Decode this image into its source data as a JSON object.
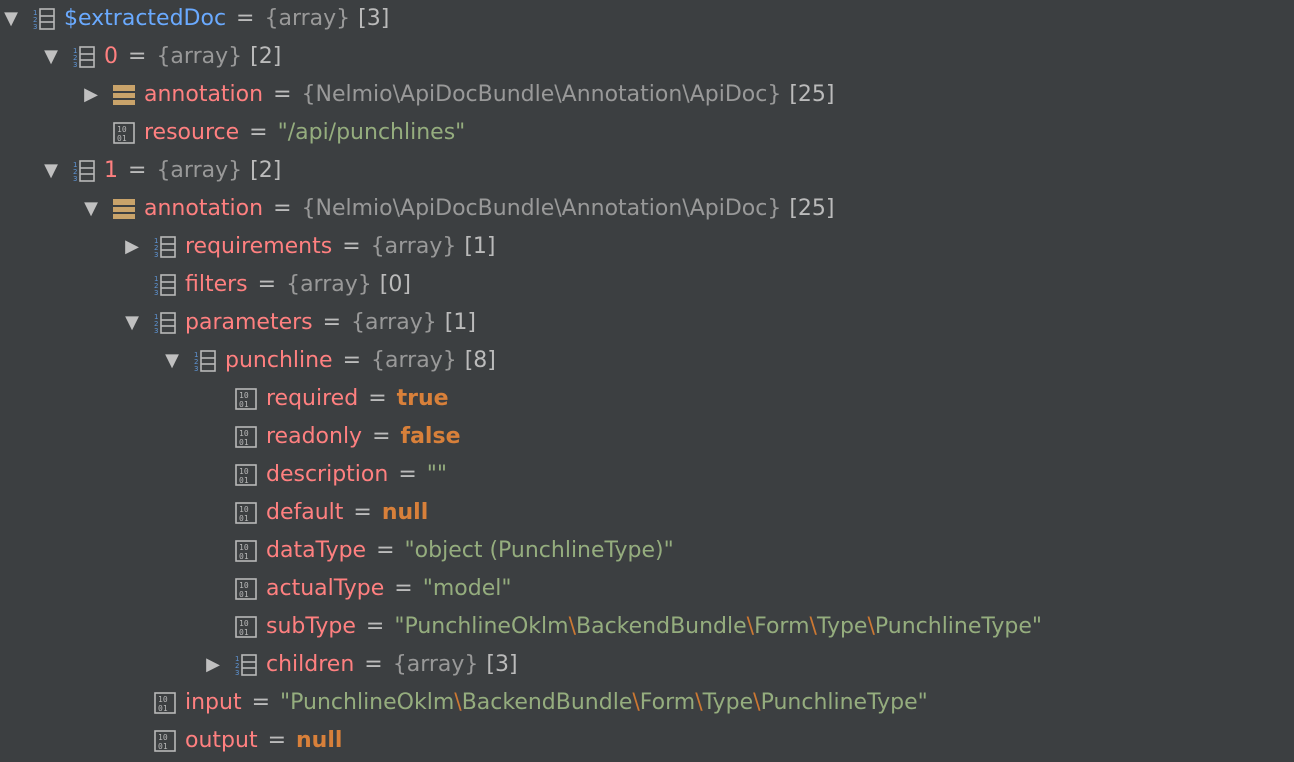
{
  "rows": [
    {
      "id": "r0",
      "name": "$extractedDoc",
      "value_type": "{array}",
      "count": "[3]"
    },
    {
      "id": "r1",
      "name": "0",
      "value_type": "{array}",
      "count": "[2]"
    },
    {
      "id": "r2",
      "name": "annotation",
      "value_type": "{Nelmio\\ApiDocBundle\\Annotation\\ApiDoc}",
      "count": "[25]"
    },
    {
      "id": "r3",
      "name": "resource",
      "value": "\"/api/punchlines\""
    },
    {
      "id": "r4",
      "name": "1",
      "value_type": "{array}",
      "count": "[2]"
    },
    {
      "id": "r5",
      "name": "annotation",
      "value_type": "{Nelmio\\ApiDocBundle\\Annotation\\ApiDoc}",
      "count": "[25]"
    },
    {
      "id": "r6",
      "name": "requirements",
      "value_type": "{array}",
      "count": "[1]"
    },
    {
      "id": "r7",
      "name": "filters",
      "value_type": "{array}",
      "count": "[0]"
    },
    {
      "id": "r8",
      "name": "parameters",
      "value_type": "{array}",
      "count": "[1]"
    },
    {
      "id": "r9",
      "name": "punchline",
      "value_type": "{array}",
      "count": "[8]"
    },
    {
      "id": "r10",
      "name": "required",
      "value": "true"
    },
    {
      "id": "r11",
      "name": "readonly",
      "value": "false"
    },
    {
      "id": "r12",
      "name": "description",
      "value": "\"\""
    },
    {
      "id": "r13",
      "name": "default",
      "value": "null"
    },
    {
      "id": "r14",
      "name": "dataType",
      "value": "\"object (PunchlineType)\""
    },
    {
      "id": "r15",
      "name": "actualType",
      "value": "\"model\""
    },
    {
      "id": "r16",
      "name": "subType",
      "value_parts": [
        "\"PunchlineOklm",
        "\\",
        "BackendBundle",
        "\\",
        "Form",
        "\\",
        "Type",
        "\\",
        "PunchlineType\""
      ]
    },
    {
      "id": "r17",
      "name": "children",
      "value_type": "{array}",
      "count": "[3]"
    },
    {
      "id": "r18",
      "name": "input",
      "value_parts": [
        "\"PunchlineOklm",
        "\\",
        "BackendBundle",
        "\\",
        "Form",
        "\\",
        "Type",
        "\\",
        "PunchlineType\""
      ]
    },
    {
      "id": "r19",
      "name": "output",
      "value": "null"
    }
  ],
  "equals": "=",
  "icons": {
    "array": "array-icon",
    "object": "object-icon",
    "primitive": "primitive-icon",
    "expanded": "expanded-arrow-icon",
    "collapsed": "collapsed-arrow-icon"
  },
  "colors": {
    "background": "#3c3f41",
    "variable": "#6aaaff",
    "key": "#ff8080",
    "string": "#95ad7e",
    "keyword": "#d8803a",
    "escape": "#cc7832",
    "type": "#999999"
  }
}
